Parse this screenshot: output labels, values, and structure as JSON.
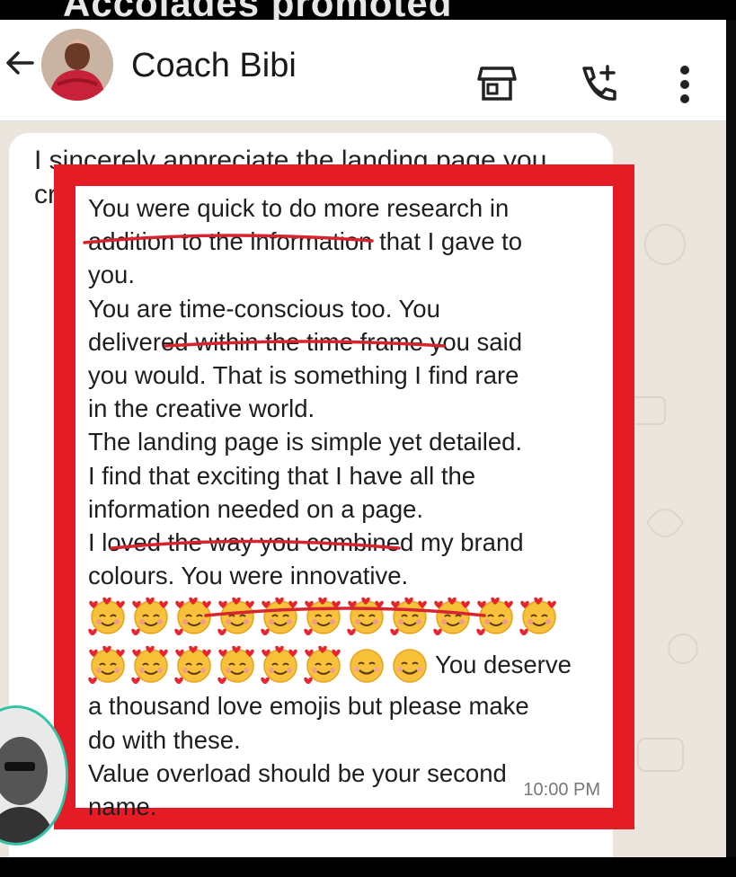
{
  "overlay_top_text": "Accolades promoted",
  "header": {
    "contact_name": "Coach Bibi",
    "icons": [
      "back-arrow-icon",
      "contact-avatar",
      "shop-icon",
      "call-add-icon",
      "more-vert-icon"
    ]
  },
  "message": {
    "first_line": "I sincerely appreciate the landing page you",
    "cut_line": "cr",
    "lines": [
      "You were quick to do more research in",
      "addition to the information that I gave to",
      "you.",
      "You are time-conscious too. You",
      "delivered within the time frame you said",
      "you would. That is something I find rare",
      "in the creative world.",
      "The landing page is simple yet detailed.",
      "I find that exciting that I have all the",
      "information needed on a page.",
      "I loved the way you combined my brand",
      "colours. You were innovative."
    ],
    "emoji_row1_count": 11,
    "emoji_row2_heart_count": 6,
    "emoji_row2_smile_count": 2,
    "after_emoji_text": "You deserve",
    "tail_lines": [
      "a thousand love emojis but please make",
      "do with these.",
      "Value overload should be your second",
      "name."
    ],
    "timestamp": "10:00 PM"
  },
  "colors": {
    "highlight_frame": "#e51b25",
    "underline": "#d8242e",
    "chat_background": "#ece5dd",
    "viewer_ring": "#2ec4a5"
  }
}
